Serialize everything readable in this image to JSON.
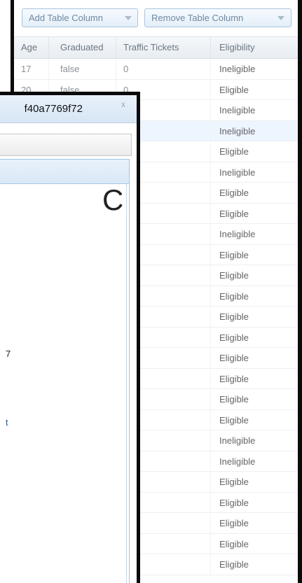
{
  "toolbar": {
    "add_column_label": "Add Table Column",
    "remove_column_label": "Remove Table Column"
  },
  "table": {
    "columns": [
      "Age",
      "Graduated",
      "Traffic Tickets",
      "Eligibility"
    ],
    "rows": [
      {
        "age": "17",
        "graduated": "false",
        "tickets": "0",
        "eligibility": "Ineligible"
      },
      {
        "age": "20",
        "graduated": "false",
        "tickets": "0",
        "eligibility": "Eligible"
      },
      {
        "age": "",
        "graduated": "",
        "tickets": "",
        "eligibility": "Ineligible"
      },
      {
        "age": "",
        "graduated": "",
        "tickets": "",
        "eligibility": "Ineligible"
      },
      {
        "age": "",
        "graduated": "",
        "tickets": "",
        "eligibility": "Eligible"
      },
      {
        "age": "",
        "graduated": "",
        "tickets": "",
        "eligibility": "Ineligible"
      },
      {
        "age": "",
        "graduated": "",
        "tickets": "",
        "eligibility": "Eligible"
      },
      {
        "age": "",
        "graduated": "",
        "tickets": "",
        "eligibility": "Eligible"
      },
      {
        "age": "",
        "graduated": "",
        "tickets": "",
        "eligibility": "Ineligible"
      },
      {
        "age": "",
        "graduated": "",
        "tickets": "",
        "eligibility": "Eligible"
      },
      {
        "age": "",
        "graduated": "",
        "tickets": "",
        "eligibility": "Eligible"
      },
      {
        "age": "",
        "graduated": "",
        "tickets": "",
        "eligibility": "Eligible"
      },
      {
        "age": "",
        "graduated": "",
        "tickets": "",
        "eligibility": "Eligible"
      },
      {
        "age": "",
        "graduated": "",
        "tickets": "",
        "eligibility": "Eligible"
      },
      {
        "age": "",
        "graduated": "",
        "tickets": "",
        "eligibility": "Eligible"
      },
      {
        "age": "",
        "graduated": "",
        "tickets": "",
        "eligibility": "Eligible"
      },
      {
        "age": "",
        "graduated": "",
        "tickets": "",
        "eligibility": "Eligible"
      },
      {
        "age": "",
        "graduated": "",
        "tickets": "",
        "eligibility": "Eligible"
      },
      {
        "age": "",
        "graduated": "",
        "tickets": "",
        "eligibility": "Ineligible"
      },
      {
        "age": "",
        "graduated": "",
        "tickets": "",
        "eligibility": "Ineligible"
      },
      {
        "age": "",
        "graduated": "",
        "tickets": "",
        "eligibility": "Eligible"
      },
      {
        "age": "",
        "graduated": "",
        "tickets": "",
        "eligibility": "Eligible"
      },
      {
        "age": "",
        "graduated": "",
        "tickets": "",
        "eligibility": "Eligible"
      },
      {
        "age": "",
        "graduated": "",
        "tickets": "",
        "eligibility": "Eligible"
      },
      {
        "age": "",
        "graduated": "",
        "tickets": "",
        "eligibility": "Eligible"
      }
    ],
    "selected_row": 3
  },
  "dialog": {
    "title_fragment": "f40a7769f72",
    "close_glyph": "x",
    "big_letter": "C",
    "text_fragment_1": "7",
    "text_fragment_2": "t"
  },
  "colors": {
    "accent_border": "#a8c5e0",
    "window_frame": "#0a0a0a",
    "selected_row": "#edf5ff"
  }
}
